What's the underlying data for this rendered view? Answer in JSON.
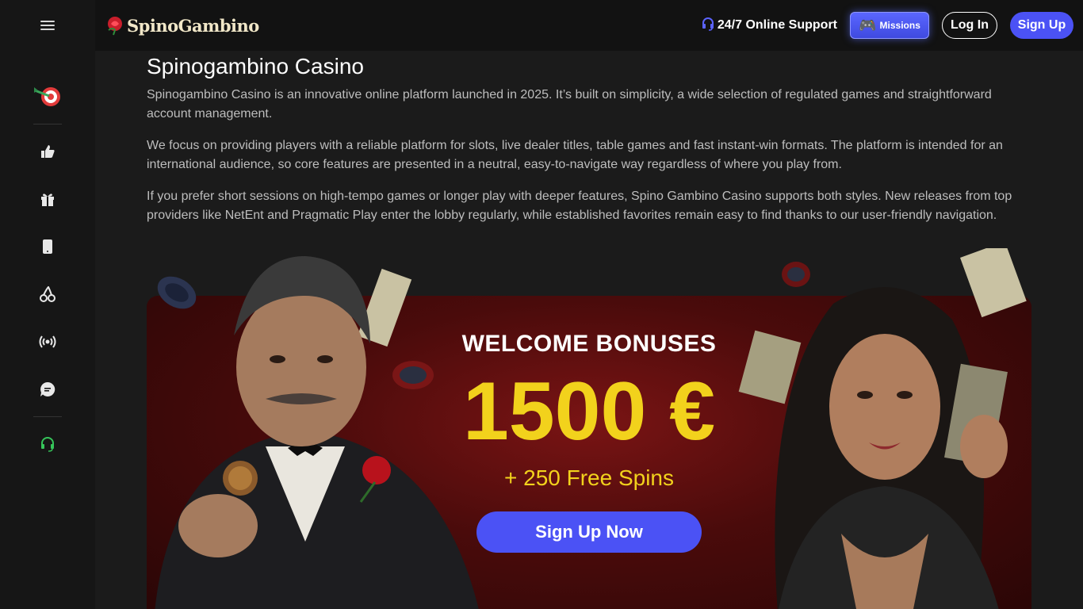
{
  "topbar": {
    "menu_icon": "hamburger-icon",
    "logo_text": "SpinoGambino",
    "support_label": "24/7 Online Support",
    "missions_label": "Missions",
    "login_label": "Log In",
    "signup_label": "Sign Up"
  },
  "sidebar": {
    "items": [
      {
        "name": "promo-dart",
        "icon": "dart-target-icon"
      },
      {
        "name": "thumbs-up",
        "icon": "thumbs-up-icon"
      },
      {
        "name": "gift",
        "icon": "gift-icon"
      },
      {
        "name": "mobile",
        "icon": "mobile-icon"
      },
      {
        "name": "cherry",
        "icon": "cherry-icon"
      },
      {
        "name": "live",
        "icon": "live-broadcast-icon"
      },
      {
        "name": "chat",
        "icon": "chat-icon"
      },
      {
        "name": "support",
        "icon": "headset-icon"
      }
    ]
  },
  "article": {
    "title": "Spinogambino Casino",
    "paragraphs": [
      "Spinogambino Casino is an innovative online platform launched in 2025. It’s built on simplicity, a wide selection of regulated games and straightforward account management.",
      "We focus on providing players with a reliable platform for slots, live dealer titles, table games and fast instant-win formats. The platform is intended for an international audience, so core features are presented in a neutral, easy-to-navigate way regardless of where you play from.",
      "If you prefer short sessions on high-tempo games or longer play with deeper features, Spino Gambino Casino supports both styles. New releases from top providers like NetEnt and Pragmatic Play enter the lobby regularly, while established favorites remain easy to find thanks to our user-friendly navigation."
    ]
  },
  "banner": {
    "heading": "WELCOME BONUSES",
    "amount": "1500 €",
    "spins": "+ 250 Free Spins",
    "cta_label": "Sign Up Now"
  },
  "colors": {
    "accent": "#4b52f5",
    "gold": "#f2d21c",
    "banner_red": "#7a1414"
  }
}
